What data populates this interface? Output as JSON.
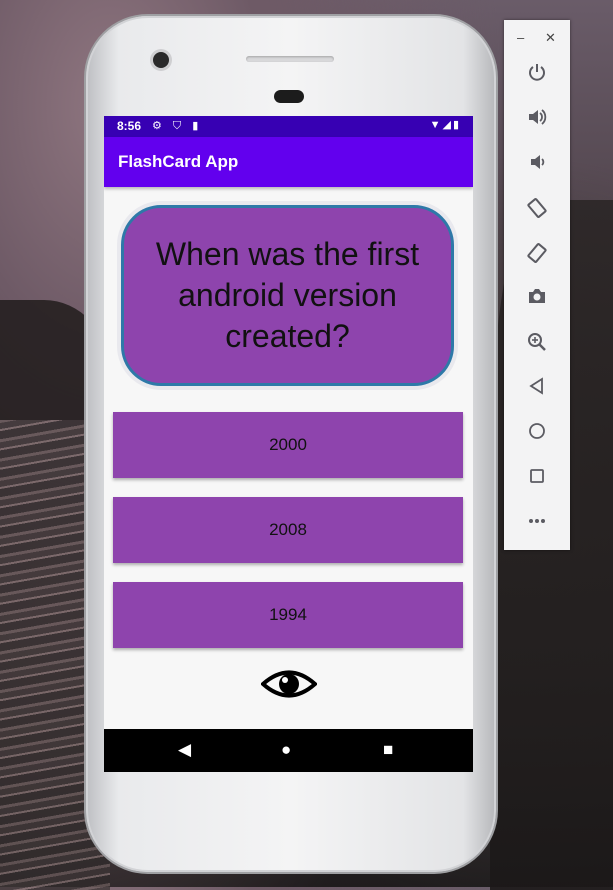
{
  "status_bar": {
    "time": "8:56"
  },
  "app": {
    "title": "FlashCard App"
  },
  "flashcard": {
    "question": "When was the first android version created?",
    "answers": [
      "2000",
      "2008",
      "1994"
    ]
  },
  "colors": {
    "status_bar": "#3700b3",
    "app_bar": "#6200ee",
    "card": "#8e44ad",
    "card_border": "#2e79a8"
  },
  "emulator_panel": {
    "icons": [
      "power-icon",
      "volume-up-icon",
      "volume-down-icon",
      "rotate-left-icon",
      "rotate-right-icon",
      "camera-icon",
      "zoom-icon",
      "back-icon",
      "home-icon",
      "overview-icon",
      "more-icon"
    ]
  }
}
